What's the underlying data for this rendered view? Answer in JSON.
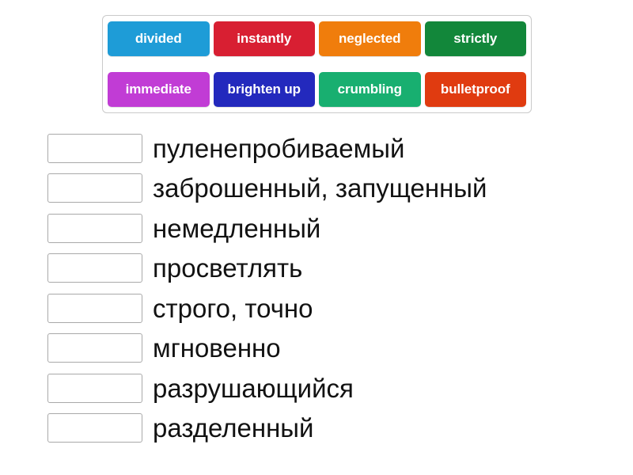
{
  "word_bank": {
    "rows": [
      [
        {
          "label": "divided",
          "color": "#1e9cd7"
        },
        {
          "label": "instantly",
          "color": "#d81f32"
        },
        {
          "label": "neglected",
          "color": "#f07d0c"
        },
        {
          "label": "strictly",
          "color": "#12873a"
        }
      ],
      [
        {
          "label": "immediate",
          "color": "#c13cd5"
        },
        {
          "label": "brighten up",
          "color": "#2329bd"
        },
        {
          "label": "crumbling",
          "color": "#18af70"
        },
        {
          "label": "bulletproof",
          "color": "#e03b10"
        }
      ]
    ]
  },
  "answers": [
    {
      "drop_placeholder": "",
      "value": "",
      "prompt": "пуленепробиваемый"
    },
    {
      "drop_placeholder": "",
      "value": "",
      "prompt": "заброшенный,  запущенный"
    },
    {
      "drop_placeholder": "",
      "value": "",
      "prompt": "немедленный"
    },
    {
      "drop_placeholder": "",
      "value": "",
      "prompt": "просветлять"
    },
    {
      "drop_placeholder": "",
      "value": "",
      "prompt": "строго, точно"
    },
    {
      "drop_placeholder": "",
      "value": "",
      "prompt": "мгновенно"
    },
    {
      "drop_placeholder": "",
      "value": "",
      "prompt": "разрушающийся"
    },
    {
      "drop_placeholder": "",
      "value": "",
      "prompt": "разделенный"
    }
  ],
  "colors": {
    "page_background": "#ffffff",
    "panel_border": "#cacaca",
    "drop_zone_border": "#a9a9a9",
    "prompt_text": "#121212",
    "tile_text": "#ffffff"
  }
}
